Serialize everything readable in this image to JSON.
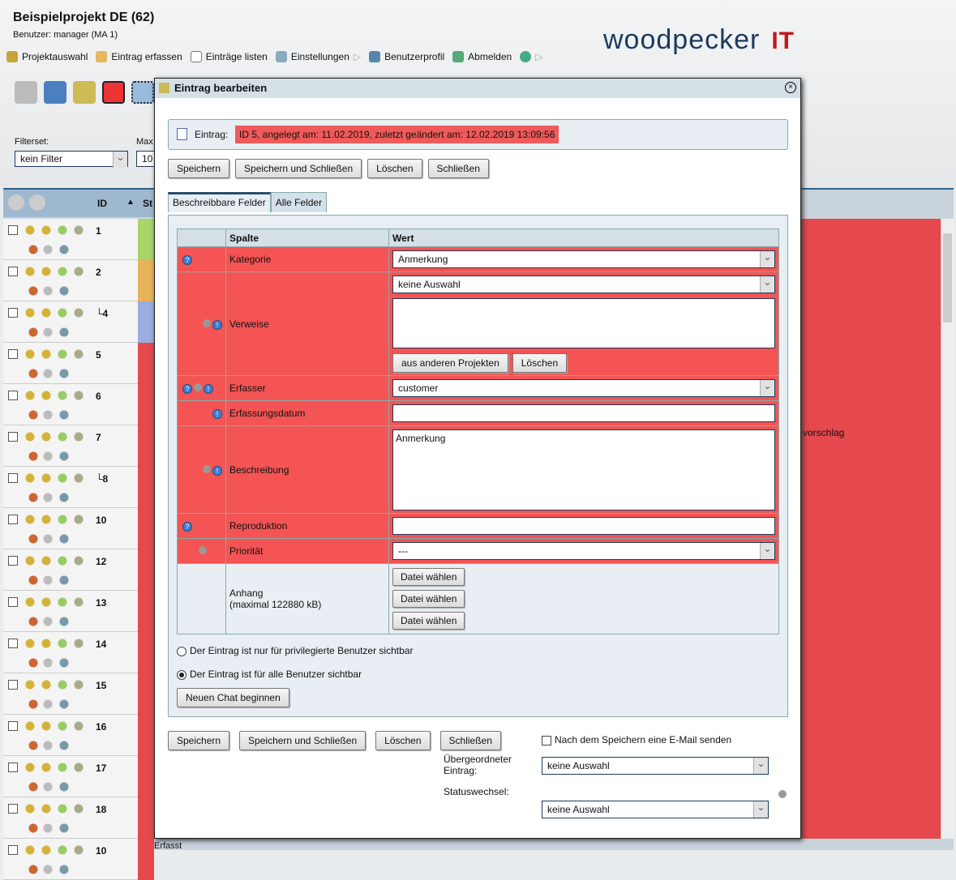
{
  "header": {
    "title": "Beispielprojekt DE (62)",
    "user": "Benutzer: manager (MA 1)",
    "logo": "woodpecker",
    "logo_suffix": "IT"
  },
  "nav": [
    "Projektauswahl",
    "Eintrag erfassen",
    "Einträge listen",
    "Einstellungen",
    "Benutzerprofil",
    "Abmelden"
  ],
  "filter": {
    "label": "Filterset:",
    "value": "kein Filter",
    "max_label": "Max",
    "max_value": "10"
  },
  "grid": {
    "id_header": "ID",
    "sort": "▲",
    "st_header": "St",
    "rows": [
      "1",
      "2",
      "└4",
      "5",
      "6",
      "7",
      "└8",
      "10",
      "12",
      "13",
      "14",
      "15",
      "16",
      "17",
      "18",
      "10"
    ],
    "bg_text": "vorschlag",
    "bottom_text": "Erfasst"
  },
  "modal": {
    "title": "Eintrag bearbeiten",
    "close": "×",
    "info_label": "Eintrag:",
    "info_value": "ID 5, angelegt am: 11.02.2019, zuletzt geändert am: 12.02.2019 13:09:56",
    "buttons": [
      "Speichern",
      "Speichern und Schließen",
      "Löschen",
      "Schließen"
    ],
    "tabs": [
      "Beschreibbare Felder",
      "Alle Felder"
    ],
    "cols": [
      "Spalte",
      "Wert"
    ],
    "fields": {
      "kategorie": {
        "label": "Kategorie",
        "value": "Anmerkung"
      },
      "verweise": {
        "label": "Verweise",
        "value": "keine Auswahl",
        "btn1": "aus anderen Projekten",
        "btn2": "Löschen"
      },
      "erfasser": {
        "label": "Erfasser",
        "value": "customer"
      },
      "datum": {
        "label": "Erfassungsdatum",
        "value": ""
      },
      "beschreibung": {
        "label": "Beschreibung",
        "value": "Anmerkung"
      },
      "reproduktion": {
        "label": "Reproduktion",
        "value": ""
      },
      "prioritaet": {
        "label": "Priorität",
        "value": "---"
      },
      "anhang": {
        "label": "Anhang",
        "sub": "(maximal 122880 kB)",
        "btn": "Datei wählen"
      }
    },
    "radio1": "Der Eintrag ist nur für privilegierte Benutzer sichtbar",
    "radio2": "Der Eintrag ist für alle Benutzer sichtbar",
    "chat": "Neuen Chat beginnen",
    "email": "Nach dem Speichern eine E-Mail senden",
    "parent_label": "Übergeordneter Eintrag:",
    "parent_value": "keine Auswahl",
    "status_label": "Statuswechsel:",
    "status_value": "keine Auswahl"
  }
}
